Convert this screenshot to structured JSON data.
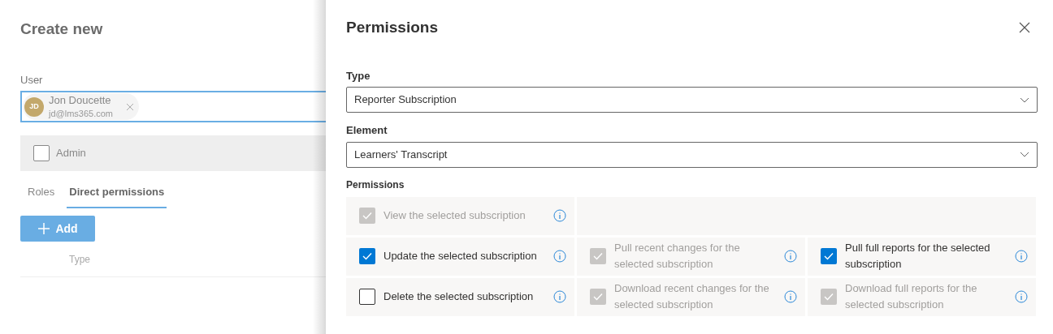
{
  "background_page": {
    "title": "Create new",
    "user_field": {
      "label": "User",
      "persona": {
        "initials": "JD",
        "name": "Jon Doucette",
        "email": "jd@lms365.com"
      }
    },
    "admin_checkbox": {
      "label": "Admin",
      "checked": false
    },
    "tabs": [
      {
        "label": "Roles",
        "selected": false
      },
      {
        "label": "Direct permissions",
        "selected": true
      }
    ],
    "add_button": "Add",
    "table": {
      "columns": [
        "Type"
      ]
    }
  },
  "dialog": {
    "title": "Permissions",
    "type_field": {
      "label": "Type",
      "value": "Reporter Subscription"
    },
    "element_field": {
      "label": "Element",
      "value": "Learners' Transcript"
    },
    "permissions_label": "Permissions",
    "permission_rows": [
      [
        {
          "label": "View the selected subscription",
          "checked": true,
          "disabled": true
        }
      ],
      [
        {
          "label": "Update the selected subscription",
          "checked": true,
          "disabled": false
        },
        {
          "label": "Pull recent changes for the selected subscription",
          "checked": true,
          "disabled": true
        },
        {
          "label": "Pull full reports for the selected subscription",
          "checked": true,
          "disabled": false
        }
      ],
      [
        {
          "label": "Delete the selected subscription",
          "checked": false,
          "disabled": false
        },
        {
          "label": "Download recent changes for the selected subscription",
          "checked": true,
          "disabled": true
        },
        {
          "label": "Download full reports for the selected subscription",
          "checked": true,
          "disabled": true
        }
      ]
    ]
  }
}
